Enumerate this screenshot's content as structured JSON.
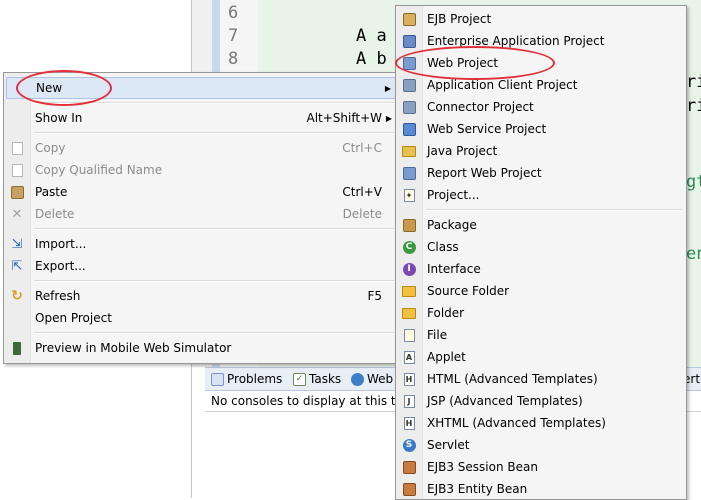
{
  "editor": {
    "lines": [
      {
        "num": "6",
        "code": ""
      },
      {
        "num": "7",
        "code": "A a"
      },
      {
        "num": "8",
        "code": "A b"
      }
    ],
    "fragments": [
      "ri",
      "ri",
      "gt",
      "en"
    ]
  },
  "console": {
    "tabs": [
      {
        "label": "Problems",
        "icon": "problems-icon"
      },
      {
        "label": "Tasks",
        "icon": "tasks-icon"
      },
      {
        "label": "Web",
        "icon": "web-browser-icon"
      },
      {
        "label": "erti",
        "icon": "properties-icon"
      }
    ],
    "message": "No consoles to display at this ti"
  },
  "context_menu": {
    "items": [
      {
        "label": "New",
        "shortcut": "",
        "submenu": true,
        "enabled": true,
        "icon": ""
      },
      {
        "label": "Show In",
        "shortcut": "Alt+Shift+W",
        "submenu": true,
        "enabled": true,
        "icon": ""
      },
      {
        "label": "Copy",
        "shortcut": "Ctrl+C",
        "enabled": false,
        "icon": "copy-icon"
      },
      {
        "label": "Copy Qualified Name",
        "shortcut": "",
        "enabled": false,
        "icon": "copy-qualified-name-icon"
      },
      {
        "label": "Paste",
        "shortcut": "Ctrl+V",
        "enabled": true,
        "icon": "paste-icon"
      },
      {
        "label": "Delete",
        "shortcut": "Delete",
        "enabled": false,
        "icon": "delete-icon"
      },
      {
        "label": "Import...",
        "shortcut": "",
        "enabled": true,
        "icon": "import-icon"
      },
      {
        "label": "Export...",
        "shortcut": "",
        "enabled": true,
        "icon": "export-icon"
      },
      {
        "label": "Refresh",
        "shortcut": "F5",
        "enabled": true,
        "icon": "refresh-icon"
      },
      {
        "label": "Open Project",
        "shortcut": "",
        "enabled": true,
        "icon": ""
      },
      {
        "label": "Preview in Mobile Web Simulator",
        "shortcut": "",
        "enabled": true,
        "icon": "mobile-simulator-icon"
      }
    ]
  },
  "new_submenu": {
    "items": [
      {
        "label": "EJB Project",
        "icon": "ejb-project-icon"
      },
      {
        "label": "Enterprise Application Project",
        "icon": "enterprise-application-icon"
      },
      {
        "label": "Web Project",
        "icon": "web-project-icon"
      },
      {
        "label": "Application Client Project",
        "icon": "application-client-icon"
      },
      {
        "label": "Connector Project",
        "icon": "connector-project-icon"
      },
      {
        "label": "Web Service Project",
        "icon": "web-service-icon"
      },
      {
        "label": "Java Project",
        "icon": "java-project-icon"
      },
      {
        "label": "Report Web Project",
        "icon": "report-web-icon"
      },
      {
        "label": "Project...",
        "icon": "new-project-icon"
      },
      {
        "label": "Package",
        "icon": "package-icon"
      },
      {
        "label": "Class",
        "icon": "class-icon"
      },
      {
        "label": "Interface",
        "icon": "interface-icon"
      },
      {
        "label": "Source Folder",
        "icon": "source-folder-icon"
      },
      {
        "label": "Folder",
        "icon": "folder-icon"
      },
      {
        "label": "File",
        "icon": "file-icon"
      },
      {
        "label": "Applet",
        "icon": "applet-icon"
      },
      {
        "label": "HTML (Advanced Templates)",
        "icon": "html-icon"
      },
      {
        "label": "JSP (Advanced Templates)",
        "icon": "jsp-icon"
      },
      {
        "label": "XHTML (Advanced Templates)",
        "icon": "xhtml-icon"
      },
      {
        "label": "Servlet",
        "icon": "servlet-icon"
      },
      {
        "label": "EJB3 Session Bean",
        "icon": "ejb3-session-bean-icon"
      },
      {
        "label": "EJB3 Entity Bean",
        "icon": "ejb3-entity-bean-icon"
      }
    ]
  },
  "colors": {
    "annotation_ring": "#e0303a",
    "menu_background": "#f5f5f5",
    "highlight": "#dde8f6",
    "code_background": "#e8f4e8"
  }
}
